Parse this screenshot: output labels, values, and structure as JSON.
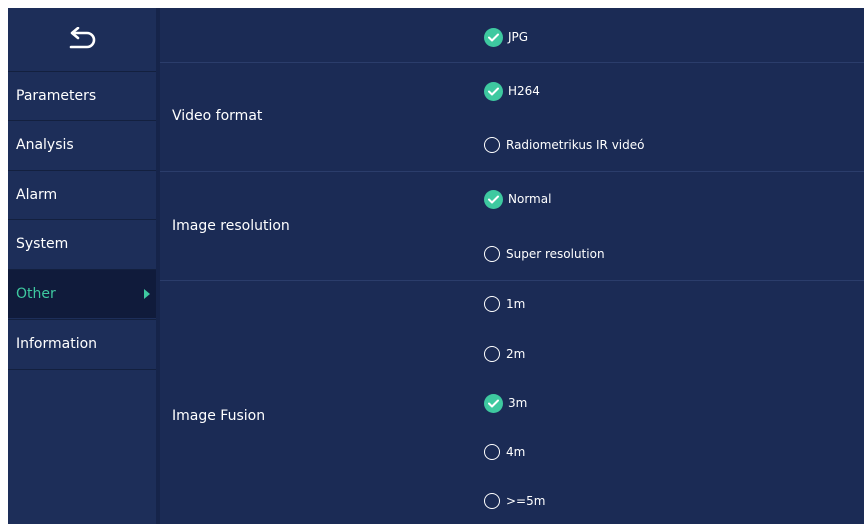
{
  "sidebar": {
    "back_icon": "undo-arrow-icon",
    "items": [
      {
        "label": "Parameters"
      },
      {
        "label": "Analysis"
      },
      {
        "label": "Alarm"
      },
      {
        "label": "System"
      },
      {
        "label": "Other",
        "active": true
      },
      {
        "label": "Information"
      }
    ]
  },
  "main": {
    "top_partial": {
      "label": "",
      "options": [
        {
          "label": "JPG",
          "checked": true
        }
      ]
    },
    "video_format": {
      "label": "Video format",
      "options": [
        {
          "label": "H264",
          "checked": true
        },
        {
          "label": "Radiometrikus IR videó",
          "checked": false
        }
      ]
    },
    "image_resolution": {
      "label": "Image resolution",
      "options": [
        {
          "label": "Normal",
          "checked": true
        },
        {
          "label": "Super resolution",
          "checked": false
        }
      ]
    },
    "image_fusion": {
      "label": "Image Fusion",
      "options": [
        {
          "label": "1m",
          "checked": false
        },
        {
          "label": "2m",
          "checked": false
        },
        {
          "label": "3m",
          "checked": true
        },
        {
          "label": "4m",
          "checked": false
        },
        {
          "label": ">=5m",
          "checked": false
        }
      ]
    }
  },
  "colors": {
    "background": "#1b2b55",
    "sidebar": "#1d2e59",
    "active_item_bg": "#101b3b",
    "accent": "#3ec9a0"
  }
}
